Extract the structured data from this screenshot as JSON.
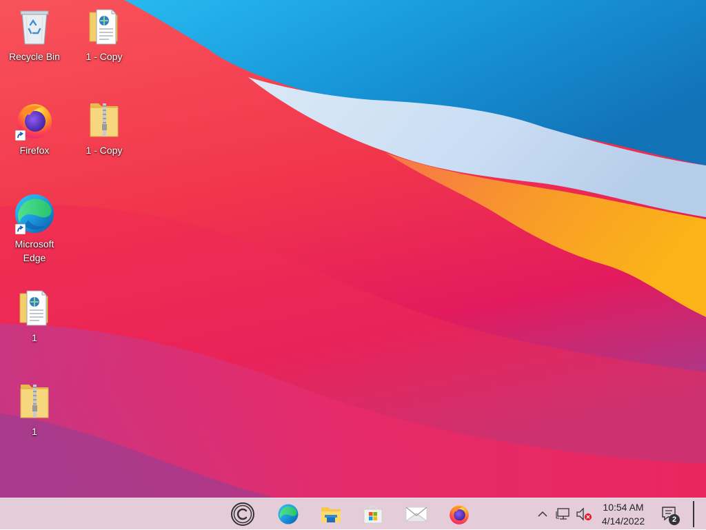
{
  "desktop": {
    "icons": [
      {
        "label": "Recycle Bin",
        "icon": "recycle-bin-icon"
      },
      {
        "label": "1 - Copy",
        "icon": "html-file-icon"
      },
      {
        "label": "Firefox",
        "icon": "firefox-icon",
        "shortcut": true
      },
      {
        "label": "1 - Copy",
        "icon": "zip-folder-icon"
      },
      {
        "label": "Microsoft\nEdge",
        "icon": "edge-icon",
        "shortcut": true
      },
      {
        "label": "1",
        "icon": "html-file-icon"
      },
      {
        "label": "1",
        "icon": "zip-folder-icon"
      }
    ]
  },
  "taskbar": {
    "apps": [
      {
        "icon": "ccleaner-icon"
      },
      {
        "icon": "edge-icon"
      },
      {
        "icon": "file-explorer-icon"
      },
      {
        "icon": "microsoft-store-icon"
      },
      {
        "icon": "mail-icon"
      },
      {
        "icon": "firefox-icon"
      }
    ],
    "tray": {
      "icons": [
        "chevron-up-icon",
        "network-icon",
        "volume-muted-icon"
      ],
      "time": "10:54 AM",
      "date": "4/14/2022",
      "notification_count": "2"
    }
  },
  "colors": {
    "taskbar": "#e2c8d6",
    "wallpaper_blue": "#1a8fd6",
    "wallpaper_red": "#f0364a",
    "wallpaper_orange": "#f7a21b"
  }
}
